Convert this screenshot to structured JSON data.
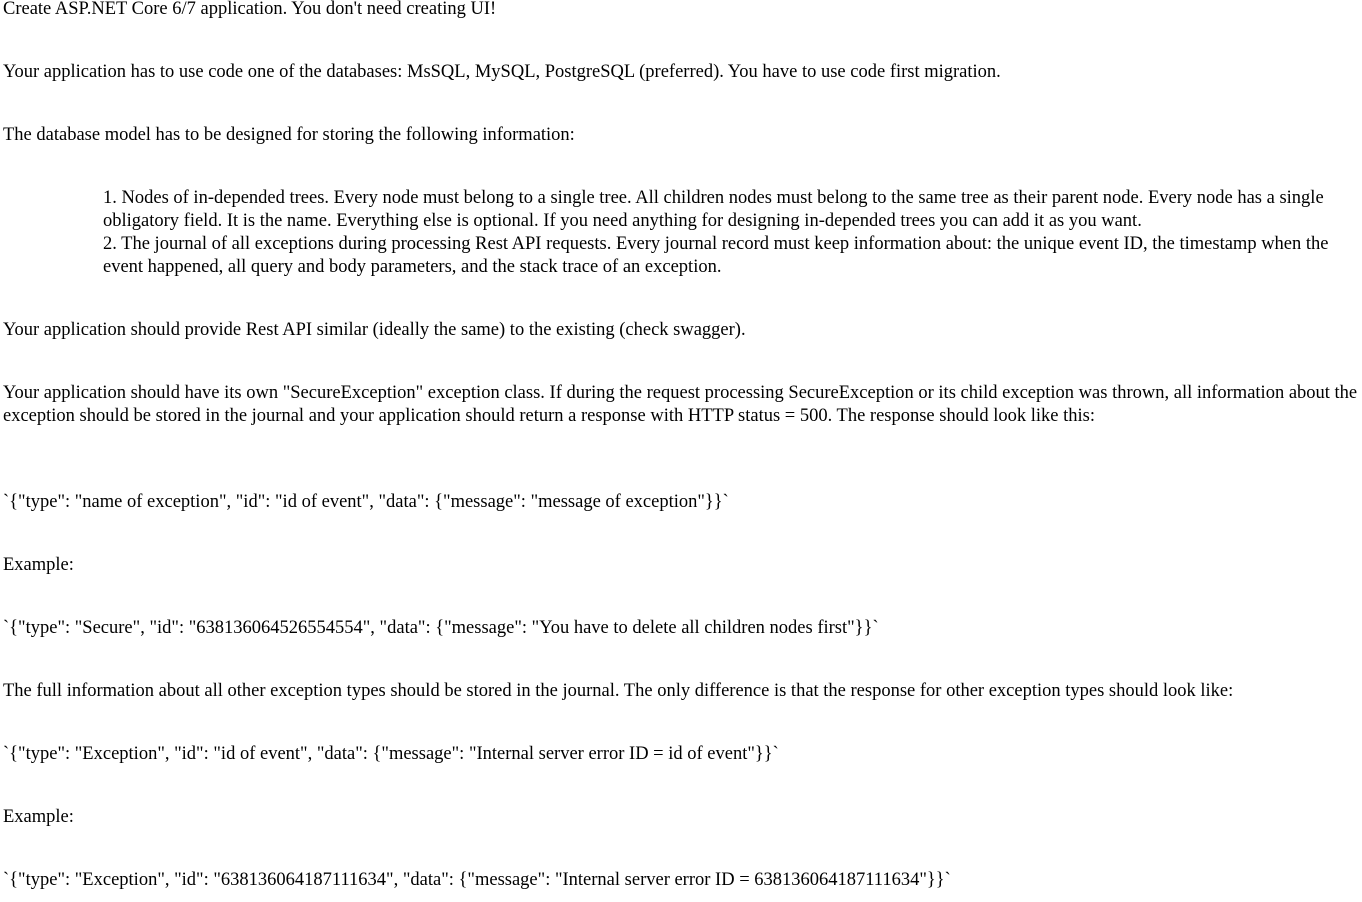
{
  "document": {
    "intro": "Create ASP.NET Core 6/7 application. You don't need creating UI!",
    "database_requirement": "Your application has to use code one of the databases: MsSQL, MySQL, PostgreSQL (preferred). You have to use code first migration.",
    "model_intro": "The database model has to be designed for storing the following information:",
    "model_items": [
      "1. Nodes of in-depended trees. Every node must belong to a single tree. All children nodes must belong to the same tree as their parent node. Every node has a single obligatory field. It is the name. Everything else is optional. If you need anything for designing in-depended trees you can add it as you want.",
      "2. The journal of all exceptions during processing Rest API requests. Every journal record must keep information about: the unique event ID, the timestamp when the event happened, all query and body parameters, and the stack trace of an exception."
    ],
    "rest_api": "Your application should provide Rest API similar (ideally the same) to the existing (check swagger).",
    "secure_exception": "Your application should have its own \"SecureException\" exception class. If during the request processing SecureException or its child exception was thrown, all information about the exception should be stored in the journal and your application should return a response with HTTP status = 500. The response should look like this:",
    "secure_format": "`{\"type\": \"name of exception\", \"id\": \"id of event\", \"data\": {\"message\": \"message of exception\"}}`",
    "example_label_1": "Example:",
    "secure_example": "`{\"type\": \"Secure\", \"id\": \"638136064526554554\", \"data\": {\"message\": \"You have to delete all children nodes first\"}}`",
    "other_exceptions": "The full information about all other exception types should be stored in the journal. The only difference is that the response for other exception types should look like:",
    "other_format": "`{\"type\": \"Exception\", \"id\": \"id of event\", \"data\": {\"message\": \"Internal server error ID = id of event\"}}`",
    "example_label_2": "Example:",
    "other_example": "`{\"type\": \"Exception\", \"id\": \"638136064187111634\", \"data\": {\"message\": \"Internal server error ID = 638136064187111634\"}}`"
  }
}
